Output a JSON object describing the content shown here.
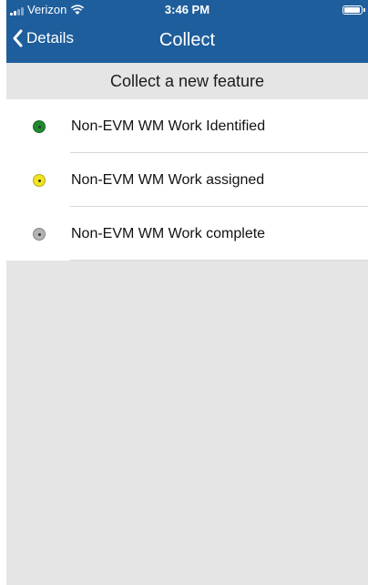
{
  "status_bar": {
    "carrier": "Verizon",
    "time": "3:46 PM",
    "battery_level": 0.95
  },
  "nav": {
    "back_label": "Details",
    "title": "Collect"
  },
  "section": {
    "header": "Collect a new feature"
  },
  "features": [
    {
      "label": "Non-EVM WM Work Identified",
      "icon": "green-dot-icon",
      "color": "#1f8a2e"
    },
    {
      "label": "Non-EVM WM Work assigned",
      "icon": "yellow-dot-icon",
      "color": "#f2e51e"
    },
    {
      "label": "Non-EVM WM Work complete",
      "icon": "gray-dot-icon",
      "color": "#b3b3b3"
    }
  ],
  "colors": {
    "nav_blue": "#1f5e9c",
    "background_gray": "#e5e5e5"
  }
}
